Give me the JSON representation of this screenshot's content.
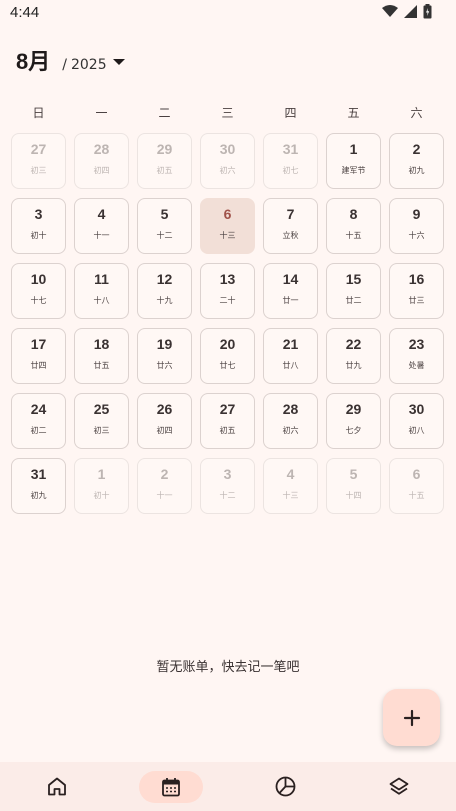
{
  "status_bar": {
    "time": "4:44"
  },
  "header": {
    "month": "8月",
    "year_slash": "/",
    "year": "2025"
  },
  "weekdays": [
    "日",
    "一",
    "二",
    "三",
    "四",
    "五",
    "六"
  ],
  "weeks": [
    [
      {
        "day": "27",
        "lunar": "初三",
        "other": true
      },
      {
        "day": "28",
        "lunar": "初四",
        "other": true
      },
      {
        "day": "29",
        "lunar": "初五",
        "other": true
      },
      {
        "day": "30",
        "lunar": "初六",
        "other": true
      },
      {
        "day": "31",
        "lunar": "初七",
        "other": true
      },
      {
        "day": "1",
        "lunar": "建军节"
      },
      {
        "day": "2",
        "lunar": "初九"
      }
    ],
    [
      {
        "day": "3",
        "lunar": "初十"
      },
      {
        "day": "4",
        "lunar": "十一"
      },
      {
        "day": "5",
        "lunar": "十二"
      },
      {
        "day": "6",
        "lunar": "十三",
        "today": true
      },
      {
        "day": "7",
        "lunar": "立秋"
      },
      {
        "day": "8",
        "lunar": "十五"
      },
      {
        "day": "9",
        "lunar": "十六"
      }
    ],
    [
      {
        "day": "10",
        "lunar": "十七"
      },
      {
        "day": "11",
        "lunar": "十八"
      },
      {
        "day": "12",
        "lunar": "十九"
      },
      {
        "day": "13",
        "lunar": "二十"
      },
      {
        "day": "14",
        "lunar": "廿一"
      },
      {
        "day": "15",
        "lunar": "廿二"
      },
      {
        "day": "16",
        "lunar": "廿三"
      }
    ],
    [
      {
        "day": "17",
        "lunar": "廿四"
      },
      {
        "day": "18",
        "lunar": "廿五"
      },
      {
        "day": "19",
        "lunar": "廿六"
      },
      {
        "day": "20",
        "lunar": "廿七"
      },
      {
        "day": "21",
        "lunar": "廿八"
      },
      {
        "day": "22",
        "lunar": "廿九"
      },
      {
        "day": "23",
        "lunar": "处暑"
      }
    ],
    [
      {
        "day": "24",
        "lunar": "初二"
      },
      {
        "day": "25",
        "lunar": "初三"
      },
      {
        "day": "26",
        "lunar": "初四"
      },
      {
        "day": "27",
        "lunar": "初五"
      },
      {
        "day": "28",
        "lunar": "初六"
      },
      {
        "day": "29",
        "lunar": "七夕"
      },
      {
        "day": "30",
        "lunar": "初八"
      }
    ],
    [
      {
        "day": "31",
        "lunar": "初九"
      },
      {
        "day": "1",
        "lunar": "初十",
        "other": true
      },
      {
        "day": "2",
        "lunar": "十一",
        "other": true
      },
      {
        "day": "3",
        "lunar": "十二",
        "other": true
      },
      {
        "day": "4",
        "lunar": "十三",
        "other": true
      },
      {
        "day": "5",
        "lunar": "十四",
        "other": true
      },
      {
        "day": "6",
        "lunar": "十五",
        "other": true
      }
    ]
  ],
  "empty_message": "暂无账单，快去记一笔吧",
  "fab": {
    "icon": "plus-icon"
  },
  "bottom_nav": [
    {
      "icon": "home-icon",
      "active": false
    },
    {
      "icon": "calendar-icon",
      "active": true
    },
    {
      "icon": "pie-chart-icon",
      "active": false
    },
    {
      "icon": "layers-icon",
      "active": false
    }
  ],
  "colors": {
    "background": "#fff6f3",
    "today_fill": "#f2dfd7",
    "today_text": "#a0524a",
    "accent": "#ffdcd2"
  }
}
